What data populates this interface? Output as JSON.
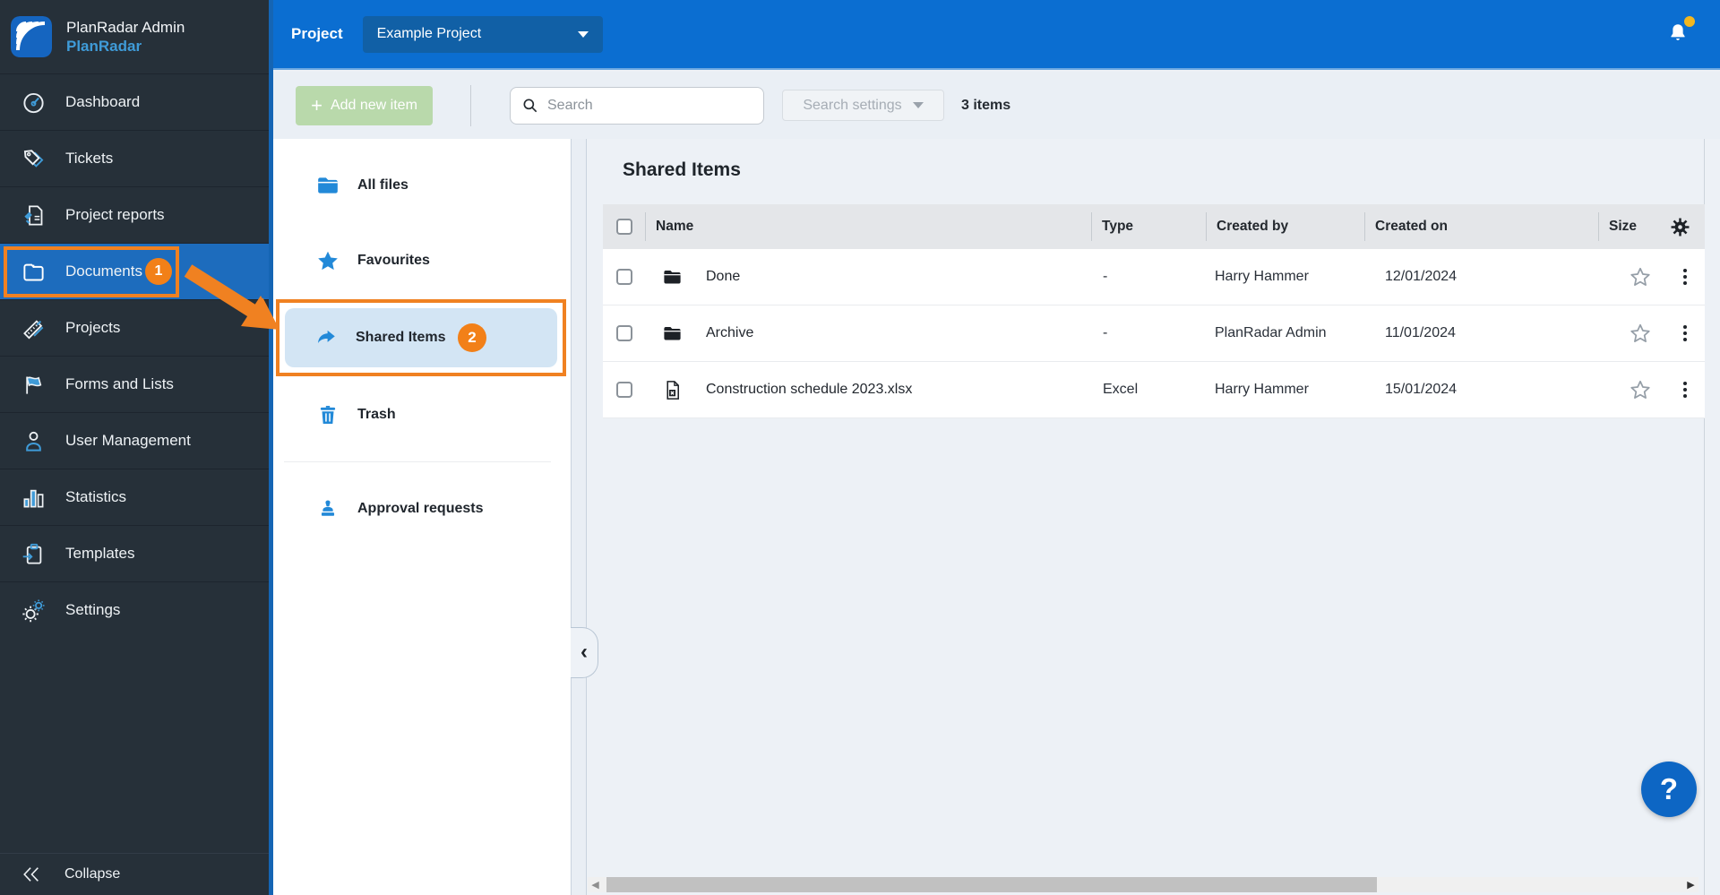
{
  "app": {
    "title": "PlanRadar Admin",
    "subtitle": "PlanRadar"
  },
  "sidebar": {
    "items": [
      {
        "label": "Dashboard"
      },
      {
        "label": "Tickets"
      },
      {
        "label": "Project reports"
      },
      {
        "label": "Documents",
        "active": true,
        "badge": "1"
      },
      {
        "label": "Projects"
      },
      {
        "label": "Forms and Lists"
      },
      {
        "label": "User Management"
      },
      {
        "label": "Statistics"
      },
      {
        "label": "Templates"
      },
      {
        "label": "Settings"
      }
    ],
    "collapse_label": "Collapse"
  },
  "topbar": {
    "project_label": "Project",
    "project_selected": "Example Project"
  },
  "toolbar": {
    "add_button": "Add new item",
    "search_placeholder": "Search",
    "search_settings": "Search settings",
    "items_count": "3 items"
  },
  "folder_nav": {
    "items": [
      {
        "label": "All files",
        "icon": "folder-icon"
      },
      {
        "label": "Favourites",
        "icon": "star-icon"
      },
      {
        "label": "Shared Items",
        "icon": "share-icon",
        "active": true,
        "badge": "2"
      },
      {
        "label": "Trash",
        "icon": "trash-icon"
      },
      {
        "label": "Approval requests",
        "icon": "stamp-icon"
      }
    ]
  },
  "main": {
    "title": "Shared Items",
    "table": {
      "columns": [
        "Name",
        "Type",
        "Created by",
        "Created on",
        "Size"
      ],
      "rows": [
        {
          "icon": "folder",
          "name": "Done",
          "type": "-",
          "created_by": "Harry Hammer",
          "created_on": "12/01/2024",
          "size": ""
        },
        {
          "icon": "folder",
          "name": "Archive",
          "type": "-",
          "created_by": "PlanRadar Admin",
          "created_on": "11/01/2024",
          "size": ""
        },
        {
          "icon": "excel",
          "name": "Construction schedule 2023.xlsx",
          "type": "Excel",
          "created_by": "Harry Hammer",
          "created_on": "15/01/2024",
          "size": ""
        }
      ]
    }
  },
  "help": {
    "label": "?"
  },
  "colors": {
    "annotation_orange": "#F08121",
    "topbar_blue": "#0b6ed1",
    "active_blue": "#1d6cbd",
    "sidebar_dark": "#263039",
    "nav_icon_blue": "#2289d8",
    "notification_yellow": "#f3b71f"
  }
}
